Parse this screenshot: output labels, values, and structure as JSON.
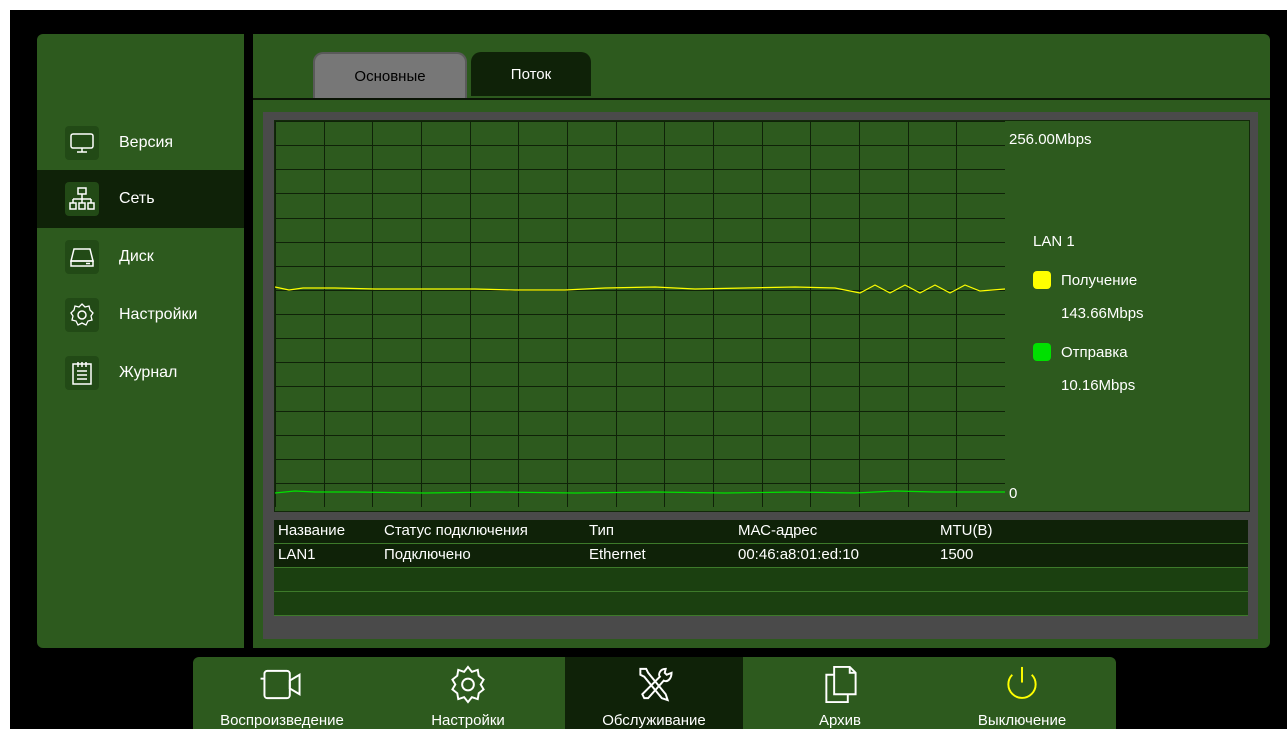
{
  "sidebar": {
    "items": [
      {
        "label": "Версия",
        "icon": "monitor-icon",
        "active": false
      },
      {
        "label": "Сеть",
        "icon": "network-icon",
        "active": true
      },
      {
        "label": "Диск",
        "icon": "disk-icon",
        "active": false
      },
      {
        "label": "Настройки",
        "icon": "gear-icon",
        "active": false
      },
      {
        "label": "Журнал",
        "icon": "log-icon",
        "active": false
      }
    ]
  },
  "tabs": [
    {
      "label": "Основные",
      "active": false
    },
    {
      "label": "Поток",
      "active": true
    }
  ],
  "graph": {
    "max_label": "256.00Mbps",
    "min_label": "0",
    "legend_title": "LAN 1",
    "receive_label": "Получение",
    "receive_value": "143.66Mbps",
    "send_label": "Отправка",
    "send_value": "10.16Mbps",
    "receive_color": "#ffff00",
    "send_color": "#00e000"
  },
  "table": {
    "headers": [
      "Название",
      "Статус подключения",
      "Тип",
      "МАС-адрес",
      "MTU(B)"
    ],
    "rows": [
      [
        "LAN1",
        "Подключено",
        "Ethernet",
        "00:46:a8:01:ed:10",
        "1500"
      ]
    ]
  },
  "bottom": {
    "items": [
      {
        "label": "Воспроизведение",
        "icon": "camera-icon"
      },
      {
        "label": "Настройки",
        "icon": "gear-icon"
      },
      {
        "label": "Обслуживание",
        "icon": "tools-icon",
        "active": true
      },
      {
        "label": "Архив",
        "icon": "archive-icon"
      },
      {
        "label": "Выключение",
        "icon": "power-icon"
      }
    ]
  }
}
